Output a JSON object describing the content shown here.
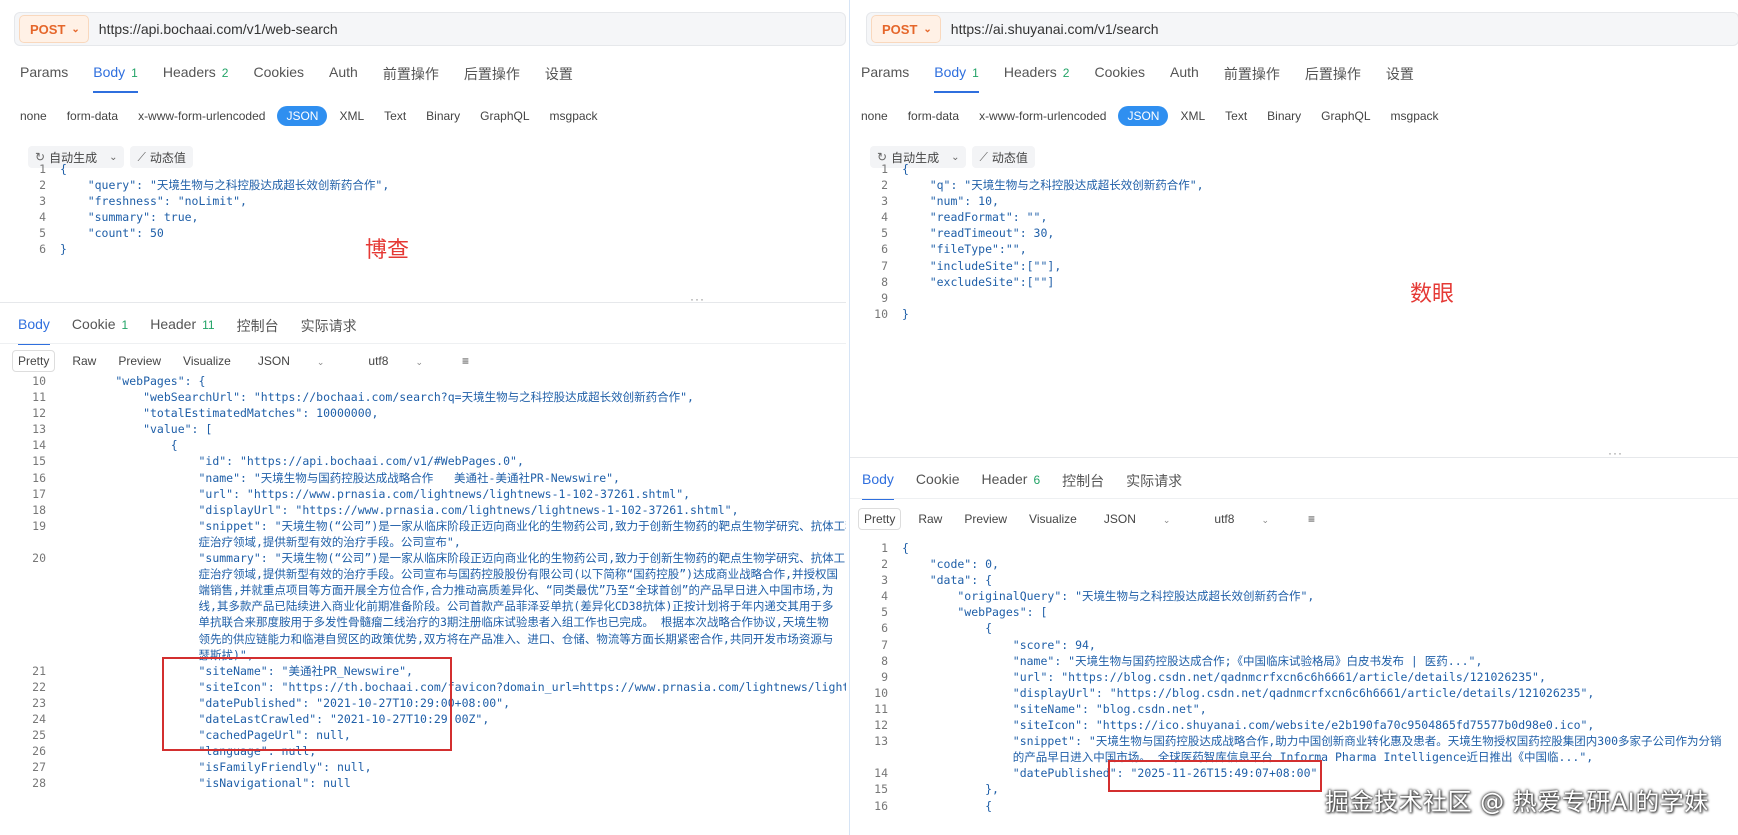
{
  "left": {
    "method": "POST",
    "url": "https://api.bochaai.com/v1/web-search",
    "tabs": [
      {
        "label": "Params",
        "count": ""
      },
      {
        "label": "Body",
        "count": "1"
      },
      {
        "label": "Headers",
        "count": "2"
      },
      {
        "label": "Cookies",
        "count": ""
      },
      {
        "label": "Auth",
        "count": ""
      },
      {
        "label": "前置操作",
        "count": ""
      },
      {
        "label": "后置操作",
        "count": ""
      },
      {
        "label": "设置",
        "count": ""
      }
    ],
    "body_types": [
      "none",
      "form-data",
      "x-www-form-urlencoded",
      "JSON",
      "XML",
      "Text",
      "Binary",
      "GraphQL",
      "msgpack"
    ],
    "toolbar": {
      "auto_label": "自动生成",
      "dynamic_label": "动态值"
    },
    "request_lines": [
      {
        "n": "1",
        "t": "{"
      },
      {
        "n": "2",
        "t": "    \"query\": \"天境生物与之科控股达成超长效创新药合作\","
      },
      {
        "n": "3",
        "t": "    \"freshness\": \"noLimit\","
      },
      {
        "n": "4",
        "t": "    \"summary\": true,"
      },
      {
        "n": "5",
        "t": "    \"count\": 50"
      },
      {
        "n": "6",
        "t": "}"
      }
    ],
    "annotation": "博查",
    "response_tabs": [
      {
        "label": "Body",
        "count": ""
      },
      {
        "label": "Cookie",
        "count": "1"
      },
      {
        "label": "Header",
        "count": "11"
      },
      {
        "label": "控制台",
        "count": ""
      },
      {
        "label": "实际请求",
        "count": ""
      }
    ],
    "view_modes": [
      "Pretty",
      "Raw",
      "Preview",
      "Visualize"
    ],
    "format": "JSON",
    "encoding": "utf8",
    "response_lines": [
      {
        "n": "10",
        "t": "        \"webPages\": {"
      },
      {
        "n": "11",
        "t": "            \"webSearchUrl\": \"https://bochaai.com/search?q=天境生物与之科控股达成超长效创新药合作\","
      },
      {
        "n": "12",
        "t": "            \"totalEstimatedMatches\": 10000000,"
      },
      {
        "n": "13",
        "t": "            \"value\": ["
      },
      {
        "n": "14",
        "t": "                {"
      },
      {
        "n": "15",
        "t": "                    \"id\": \"https://api.bochaai.com/v1/#WebPages.0\","
      },
      {
        "n": "16",
        "t": "                    \"name\": \"天境生物与国药控股达成战略合作   美通社-美通社PR-Newswire\","
      },
      {
        "n": "17",
        "t": "                    \"url\": \"https://www.prnasia.com/lightnews/lightnews-1-102-37261.shtml\","
      },
      {
        "n": "18",
        "t": "                    \"displayUrl\": \"https://www.prnasia.com/lightnews/lightnews-1-102-37261.shtml\","
      },
      {
        "n": "19",
        "t": "                    \"snippet\": \"天境生物(“公司”)是一家从临床阶段正迈向商业化的生物药公司,致力于创新生物药的靶点生物学研究、抗体工程、\n                    症治疗领域,提供新型有效的治疗手段。公司宣布\","
      },
      {
        "n": "20",
        "t": "                    \"summary\": \"天境生物(“公司”)是一家从临床阶段正迈向商业化的生物药公司,致力于创新生物药的靶点生物学研究、抗体工\n                    症治疗领域,提供新型有效的治疗手段。公司宣布与国药控股股份有限公司(以下简称“国药控股”)达成商业战略合作,并授权国\n                    端销售,并就重点项目等方面开展全方位合作,合力推动高质差异化、“同类最优”乃至“全球首创”的产品早日进入中国市场,为\n                    线,其多款产品已陆续进入商业化前期准备阶段。公司首款产品菲泽妥单抗(差异化CD38抗体)正按计划将于年内递交其用于多\n                    单抗联合来那度胺用于多发性骨髓瘤二线治疗的3期注册临床试验患者入组工作也已完成。 根据本次战略合作协议,天境生物\n                    领先的供应链能力和临港自贸区的政策优势,双方将在产品准入、进口、仓储、物流等方面长期紧密合作,共同开发市场资源与\n                    瑟斯扰)\","
      },
      {
        "n": "21",
        "t": "                    \"siteName\": \"美通社PR_Newswire\","
      },
      {
        "n": "22",
        "t": "                    \"siteIcon\": \"https://th.bochaai.com/favicon?domain_url=https://www.prnasia.com/lightnews/lightnews-1"
      },
      {
        "n": "23",
        "t": "                    \"datePublished\": \"2021-10-27T10:29:00+08:00\","
      },
      {
        "n": "24",
        "t": "                    \"dateLastCrawled\": \"2021-10-27T10:29:00Z\","
      },
      {
        "n": "25",
        "t": "                    \"cachedPageUrl\": null,"
      },
      {
        "n": "26",
        "t": "                    \"language\": null,"
      },
      {
        "n": "27",
        "t": "                    \"isFamilyFriendly\": null,"
      },
      {
        "n": "28",
        "t": "                    \"isNavigational\": null"
      }
    ]
  },
  "right": {
    "method": "POST",
    "url": "https://ai.shuyanai.com/v1/search",
    "tabs": [
      {
        "label": "Params",
        "count": ""
      },
      {
        "label": "Body",
        "count": "1"
      },
      {
        "label": "Headers",
        "count": "2"
      },
      {
        "label": "Cookies",
        "count": ""
      },
      {
        "label": "Auth",
        "count": ""
      },
      {
        "label": "前置操作",
        "count": ""
      },
      {
        "label": "后置操作",
        "count": ""
      },
      {
        "label": "设置",
        "count": ""
      }
    ],
    "body_types": [
      "none",
      "form-data",
      "x-www-form-urlencoded",
      "JSON",
      "XML",
      "Text",
      "Binary",
      "GraphQL",
      "msgpack"
    ],
    "toolbar": {
      "auto_label": "自动生成",
      "dynamic_label": "动态值"
    },
    "request_lines": [
      {
        "n": "1",
        "t": "{"
      },
      {
        "n": "2",
        "t": "    \"q\": \"天境生物与之科控股达成超长效创新药合作\","
      },
      {
        "n": "3",
        "t": "    \"num\": 10,"
      },
      {
        "n": "4",
        "t": "    \"readFormat\": \"\","
      },
      {
        "n": "5",
        "t": "    \"readTimeout\": 30,"
      },
      {
        "n": "6",
        "t": "    \"fileType\":\"\","
      },
      {
        "n": "7",
        "t": "    \"includeSite\":[\"\"],"
      },
      {
        "n": "8",
        "t": "    \"excludeSite\":[\"\"]"
      },
      {
        "n": "9",
        "t": ""
      },
      {
        "n": "10",
        "t": "}"
      }
    ],
    "annotation": "数眼",
    "response_tabs": [
      {
        "label": "Body",
        "count": ""
      },
      {
        "label": "Cookie",
        "count": ""
      },
      {
        "label": "Header",
        "count": "6"
      },
      {
        "label": "控制台",
        "count": ""
      },
      {
        "label": "实际请求",
        "count": ""
      }
    ],
    "view_modes": [
      "Pretty",
      "Raw",
      "Preview",
      "Visualize"
    ],
    "format": "JSON",
    "encoding": "utf8",
    "response_lines": [
      {
        "n": "1",
        "t": "{"
      },
      {
        "n": "2",
        "t": "    \"code\": 0,"
      },
      {
        "n": "3",
        "t": "    \"data\": {"
      },
      {
        "n": "4",
        "t": "        \"originalQuery\": \"天境生物与之科控股达成超长效创新药合作\","
      },
      {
        "n": "5",
        "t": "        \"webPages\": ["
      },
      {
        "n": "6",
        "t": "            {"
      },
      {
        "n": "7",
        "t": "                \"score\": 94,"
      },
      {
        "n": "8",
        "t": "                \"name\": \"天境生物与国药控股达成合作;《中国临床试验格局》白皮书发布 | 医药...\","
      },
      {
        "n": "9",
        "t": "                \"url\": \"https://blog.csdn.net/qadnmcrfxcn6c6h6661/article/details/121026235\","
      },
      {
        "n": "10",
        "t": "                \"displayUrl\": \"https://blog.csdn.net/qadnmcrfxcn6c6h6661/article/details/121026235\","
      },
      {
        "n": "11",
        "t": "                \"siteName\": \"blog.csdn.net\","
      },
      {
        "n": "12",
        "t": "                \"siteIcon\": \"https://ico.shuyanai.com/website/e2b190fa70c9504865fd75577b0d98e0.ico\","
      },
      {
        "n": "13",
        "t": "                \"snippet\": \"天境生物与国药控股达成战略合作,助力中国创新商业转化惠及患者。天境生物授权国药控股集团内300多家子公司作为分销\n                的产品早日进入中国市场。 全球医药智库信息平台 Informa Pharma Intelligence近日推出《中国临...\","
      },
      {
        "n": "14",
        "t": "                \"datePublished\": \"2025-11-26T15:49:07+08:00\""
      },
      {
        "n": "15",
        "t": "            },"
      },
      {
        "n": "16",
        "t": "            {"
      }
    ]
  },
  "watermark": "掘金技术社区 @ 热爱专研AI的学妹"
}
